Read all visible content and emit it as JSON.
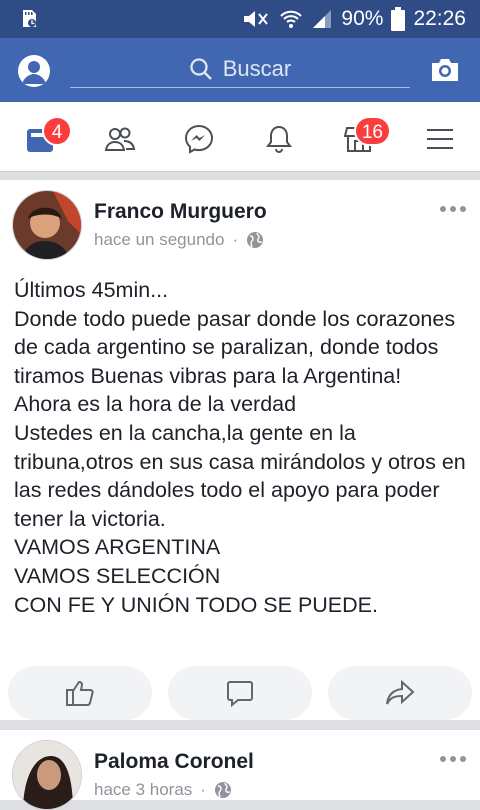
{
  "status_bar": {
    "battery_percent": "90%",
    "time": "22:26"
  },
  "top_bar": {
    "search_placeholder": "Buscar"
  },
  "nav": {
    "items": [
      {
        "name": "news-feed",
        "badge": "4"
      },
      {
        "name": "friends",
        "badge": ""
      },
      {
        "name": "messenger",
        "badge": ""
      },
      {
        "name": "notifications",
        "badge": ""
      },
      {
        "name": "marketplace",
        "badge": "16"
      },
      {
        "name": "menu",
        "badge": ""
      }
    ]
  },
  "posts": [
    {
      "author": "Franco Murguero",
      "timestamp": "hace un segundo",
      "privacy_icon": "globe-icon",
      "text": "Últimos 45min...\nDonde todo puede pasar donde los corazones de cada argentino se paralizan, donde todos tiramos Buenas vibras para la Argentina!\nAhora es la hora de la verdad\nUstedes en la cancha,la gente en la tribuna,otros en sus casa mirándolos y otros en las redes dándoles todo el apoyo para poder tener la victoria.\nVAMOS ARGENTINA\nVAMOS SELECCIÓN\nCON FE Y UNIÓN TODO SE PUEDE."
    },
    {
      "author": "Paloma Coronel",
      "timestamp": "hace 3 horas",
      "privacy_icon": "globe-icon"
    }
  ],
  "colors": {
    "status_bar": "#2f4c87",
    "top_bar": "#4267b2",
    "badge": "#fa3e3e",
    "active_nav": "#4267b2",
    "inactive_nav": "#4b4f56"
  }
}
